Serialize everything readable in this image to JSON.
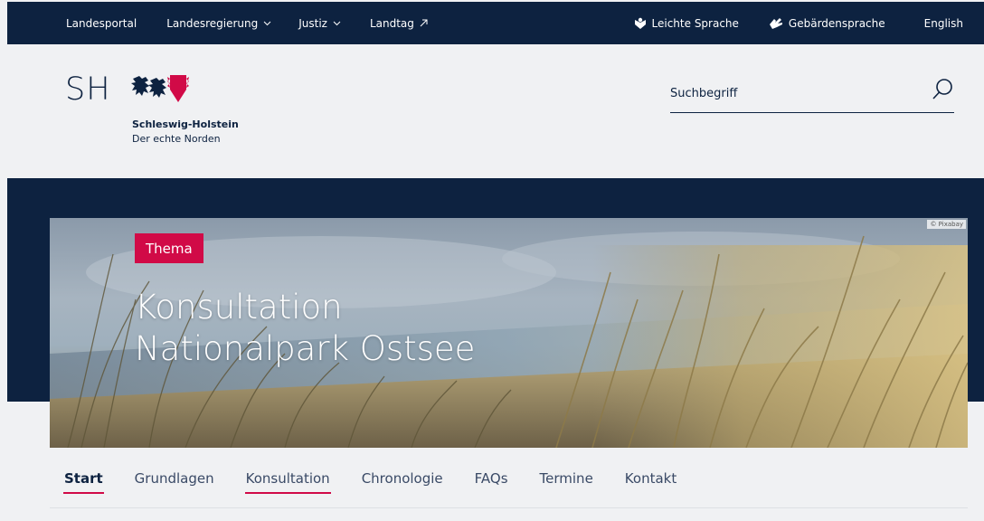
{
  "topbar": {
    "items": [
      {
        "label": "Landesportal"
      },
      {
        "label": "Landesregierung"
      },
      {
        "label": "Justiz"
      },
      {
        "label": "Landtag"
      }
    ],
    "right_items": [
      {
        "label": "Leichte Sprache",
        "icon": "easy-language-icon"
      },
      {
        "label": "Gebärdensprache",
        "icon": "sign-language-icon"
      },
      {
        "label": "English"
      }
    ]
  },
  "logo": {
    "abbr": "SH",
    "name": "Schleswig-Holstein",
    "claim": "Der echte Norden"
  },
  "search": {
    "placeholder": "Suchbegriff",
    "value": ""
  },
  "hero": {
    "image_credit": "© Pixabay",
    "tag": "Thema",
    "title_line1": "Konsultation",
    "title_line2": "Nationalpark Ostsee"
  },
  "subnav": {
    "tabs": [
      {
        "label": "Start",
        "active": true
      },
      {
        "label": "Grundlagen"
      },
      {
        "label": "Konsultation",
        "underlined": true
      },
      {
        "label": "Chronologie"
      },
      {
        "label": "FAQs"
      },
      {
        "label": "Termine"
      },
      {
        "label": "Kontakt"
      }
    ]
  },
  "colors": {
    "navy": "#0d2240",
    "accent": "#d10a47",
    "header_bg": "#f0f1f3"
  }
}
